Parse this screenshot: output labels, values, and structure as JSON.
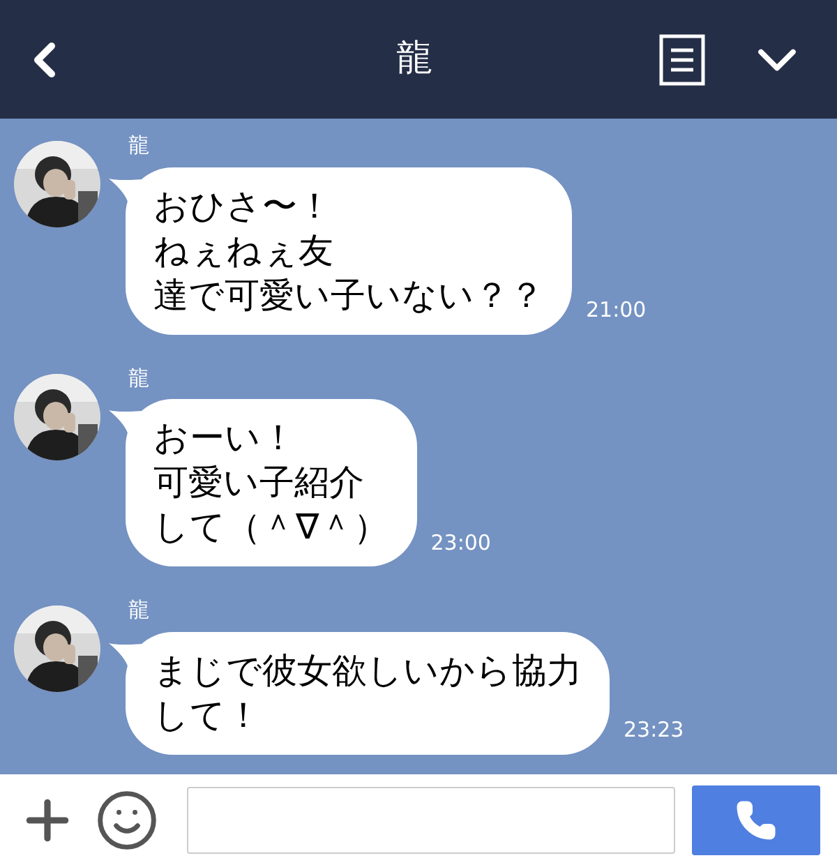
{
  "header": {
    "title": "龍"
  },
  "messages": [
    {
      "sender": "龍",
      "lines": [
        "おひさ〜！",
        "ねぇねぇ友",
        "達で可愛い子いない？？"
      ],
      "time": "21:00"
    },
    {
      "sender": "龍",
      "lines": [
        "おーい！",
        "可愛い子紹介",
        "して（＾∇＾）"
      ],
      "time": "23:00"
    },
    {
      "sender": "龍",
      "lines": [
        "まじで彼女欲しいから協力",
        "して！"
      ],
      "time": "23:23"
    }
  ]
}
